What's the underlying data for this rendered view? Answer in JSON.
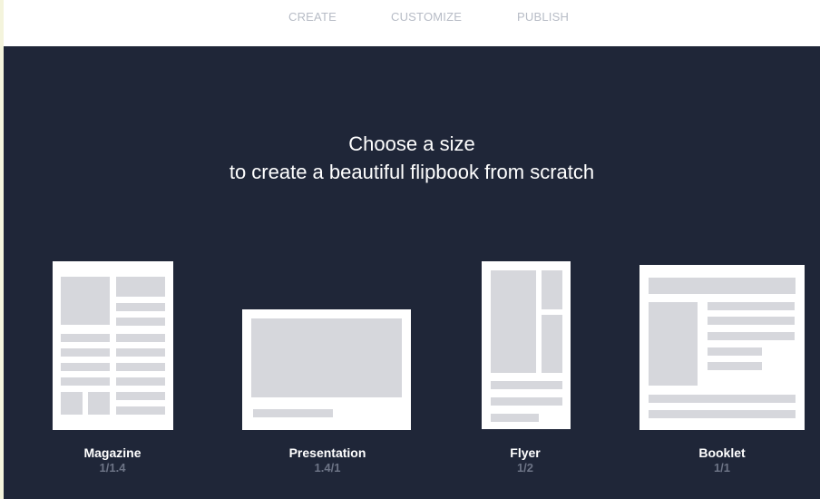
{
  "steps": {
    "create": "CREATE",
    "customize": "CUSTOMIZE",
    "publish": "PUBLISH"
  },
  "heading": {
    "line1": "Choose a size",
    "line2": "to create a beautiful flipbook from scratch"
  },
  "sizes": [
    {
      "name": "Magazine",
      "ratio": "1/1.4"
    },
    {
      "name": "Presentation",
      "ratio": "1.4/1"
    },
    {
      "name": "Flyer",
      "ratio": "1/2"
    },
    {
      "name": "Booklet",
      "ratio": "1/1"
    }
  ],
  "colors": {
    "background": "#1f2638",
    "sheet": "#ffffff",
    "placeholder": "#d6d7dc",
    "step_text": "#b7bcc6",
    "ratio_text": "#6d7486"
  }
}
